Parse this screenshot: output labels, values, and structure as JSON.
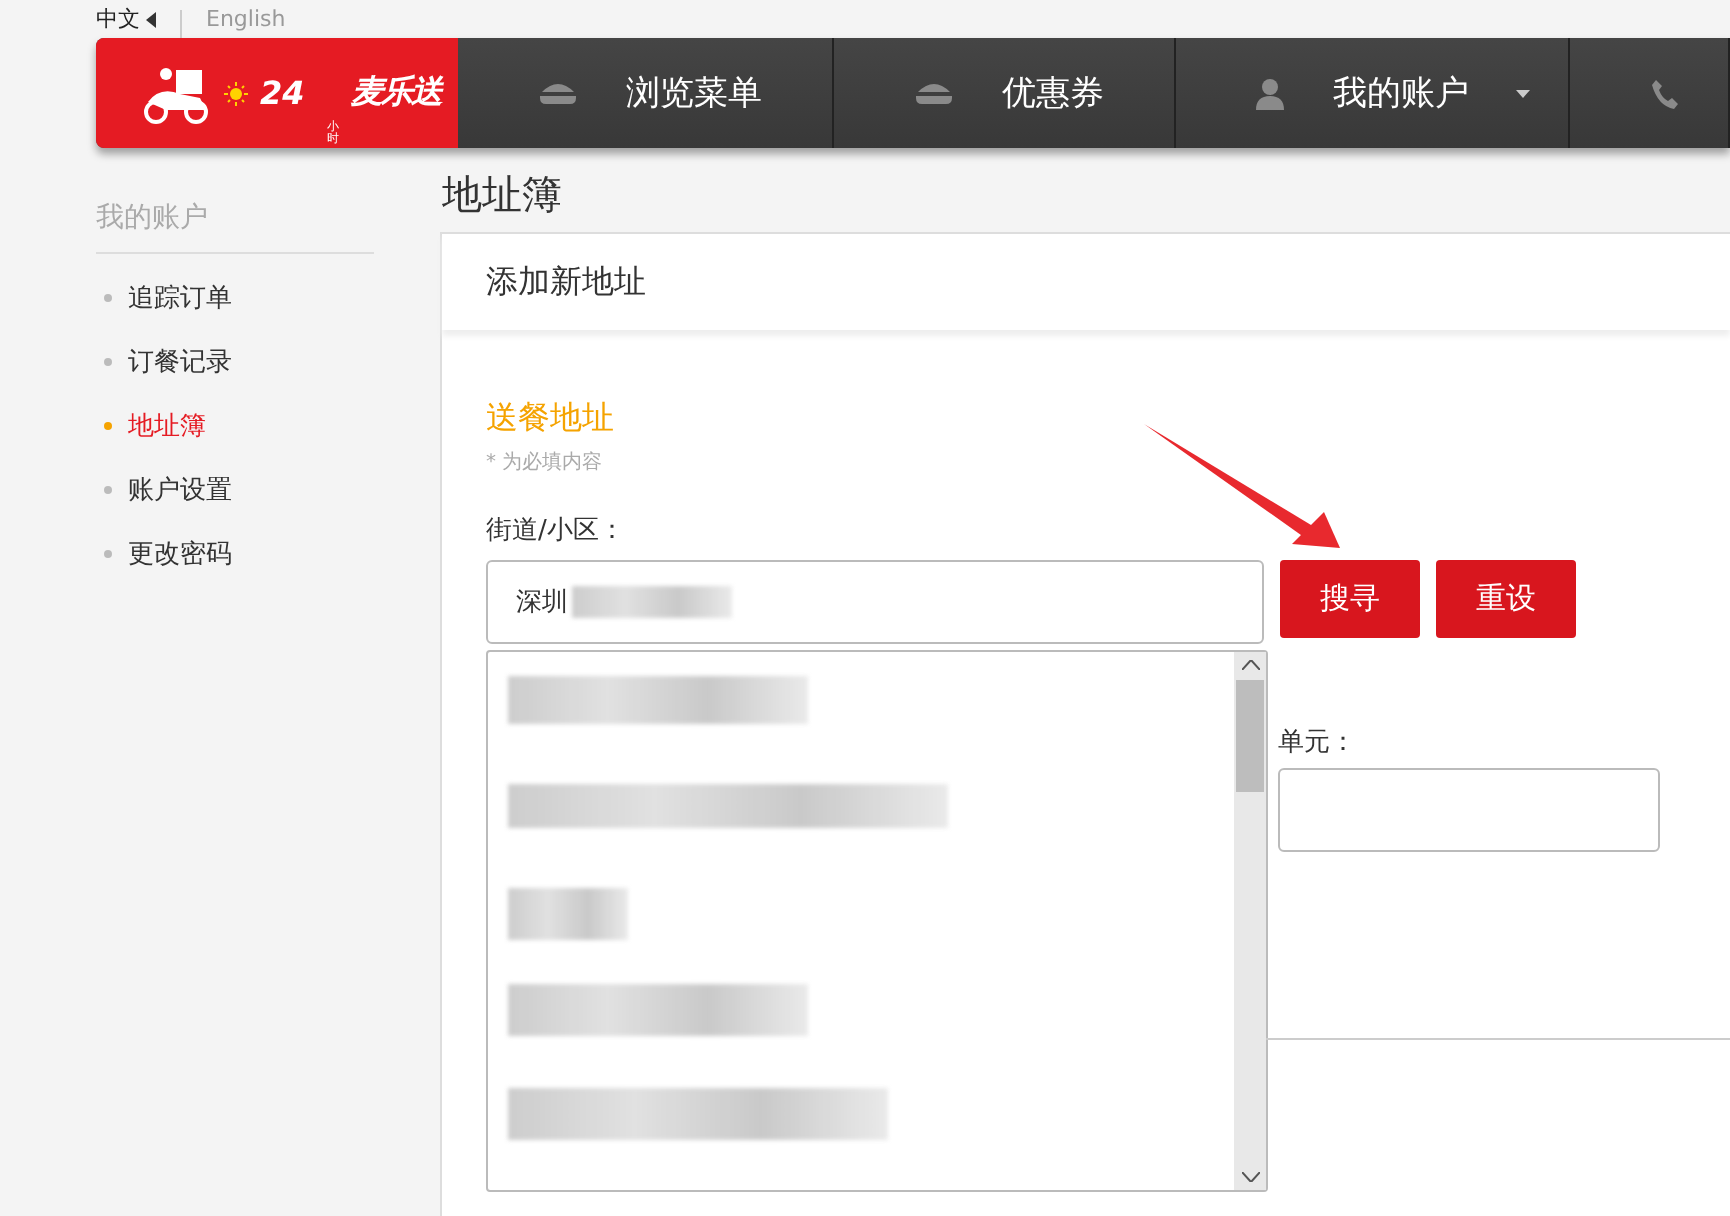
{
  "language_bar": {
    "items": [
      {
        "label": "中文",
        "selected": true
      },
      {
        "label": "English",
        "selected": false
      }
    ]
  },
  "logo": {
    "number": "24",
    "unit": "小时",
    "name": "麦乐送"
  },
  "nav": [
    {
      "label": "浏览菜单",
      "kind": "menu",
      "dropdown": false
    },
    {
      "label": "优惠券",
      "kind": "coupon",
      "dropdown": false
    },
    {
      "label": "我的账户",
      "kind": "account",
      "dropdown": true
    },
    {
      "kind": "phone",
      "dropdown": false
    }
  ],
  "sidebar": {
    "title": "我的账户",
    "items": [
      {
        "label": "追踪订单",
        "selected": false
      },
      {
        "label": "订餐记录",
        "selected": false
      },
      {
        "label": "地址簿",
        "selected": true
      },
      {
        "label": "账户设置",
        "selected": false
      },
      {
        "label": "更改密码",
        "selected": false
      }
    ]
  },
  "page_title": "地址簿",
  "card": {
    "title": "添加新地址",
    "section_title": "送餐地址",
    "required_note": "* 为必填内容",
    "street": {
      "label": "街道/小区：",
      "value": "深圳"
    },
    "buttons": [
      {
        "label": "搜寻"
      },
      {
        "label": "重设"
      }
    ],
    "unit": {
      "label": "单元："
    }
  }
}
